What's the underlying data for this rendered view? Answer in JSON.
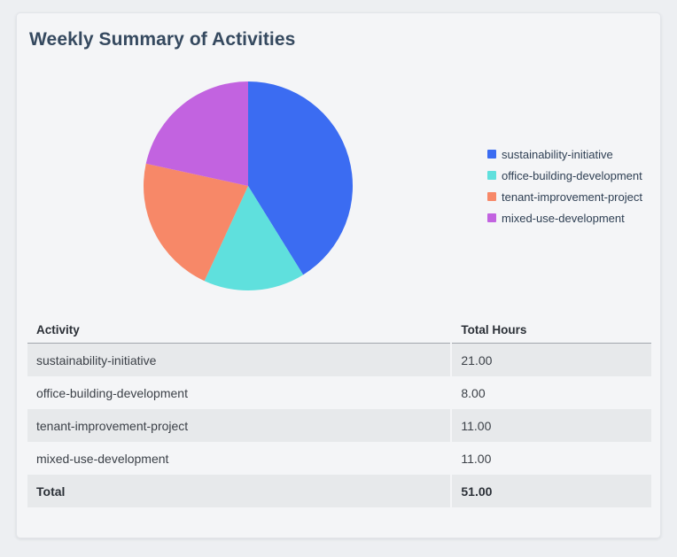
{
  "card": {
    "title": "Weekly Summary of Activities"
  },
  "chart_data": {
    "type": "pie",
    "title": "Weekly Summary of Activities",
    "categories": [
      "sustainability-initiative",
      "office-building-development",
      "tenant-improvement-project",
      "mixed-use-development"
    ],
    "values": [
      21,
      8,
      11,
      11
    ],
    "total": 51,
    "colors": [
      "#3b6cf2",
      "#5fe0dd",
      "#f78868",
      "#c263e0"
    ],
    "legend_position": "right",
    "start_angle_deg": 0,
    "direction": "clockwise"
  },
  "table": {
    "columns": [
      "Activity",
      "Total Hours"
    ],
    "rows": [
      {
        "activity": "sustainability-initiative",
        "hours": "21.00"
      },
      {
        "activity": "office-building-development",
        "hours": "8.00"
      },
      {
        "activity": "tenant-improvement-project",
        "hours": "11.00"
      },
      {
        "activity": "mixed-use-development",
        "hours": "11.00"
      }
    ],
    "total_row": {
      "activity": "Total",
      "hours": "51.00"
    }
  },
  "colors": {
    "page_bg": "#edeff2",
    "card_bg": "#f4f5f7",
    "stripe": "#e7e9eb",
    "title_text": "#35495f",
    "header_border": "#a1a6ad"
  }
}
